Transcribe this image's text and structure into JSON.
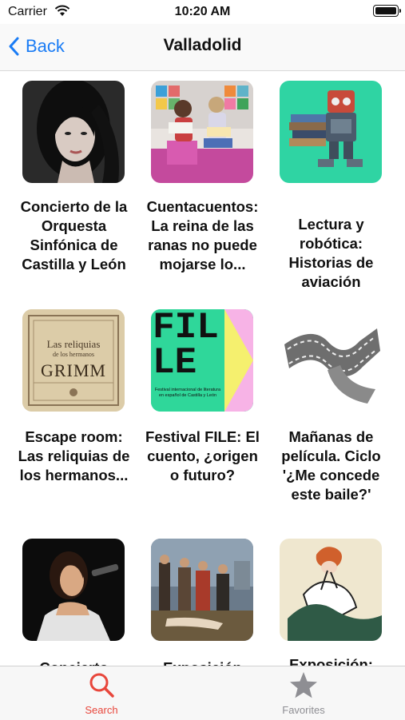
{
  "status_bar": {
    "carrier": "Carrier",
    "time": "10:20 AM"
  },
  "nav": {
    "back_label": "Back",
    "title": "Valladolid"
  },
  "events": [
    {
      "title": "Concierto de la Orquesta Sinfónica de Castilla y León"
    },
    {
      "title": "Cuentacuentos: La reina de las ranas no puede mojarse lo..."
    },
    {
      "title": "Lectura y robótica: Historias de aviación"
    },
    {
      "title": "Escape room: Las reliquias de los hermanos..."
    },
    {
      "title": "Festival FILE: El cuento, ¿origen o futuro?"
    },
    {
      "title": "Mañanas de película. Ciclo '¿Me concede este baile?'"
    },
    {
      "title": "Concierto"
    },
    {
      "title": "Exposición"
    },
    {
      "title": "Exposición:"
    }
  ],
  "thumb_texts": {
    "grimm_line1": "Las reliquias",
    "grimm_line2": "de los hermanos",
    "grimm_big": "GRIMM",
    "file_big1": "FIL",
    "file_big2": "LE",
    "file_sub": "Festival internacional de literatura en español de Castilla y León"
  },
  "tabs": {
    "search_label": "Search",
    "favorites_label": "Favorites"
  },
  "colors": {
    "accent_blue": "#1a7cf5",
    "tab_active": "#e8463b",
    "tab_inactive": "#8e8e93"
  }
}
